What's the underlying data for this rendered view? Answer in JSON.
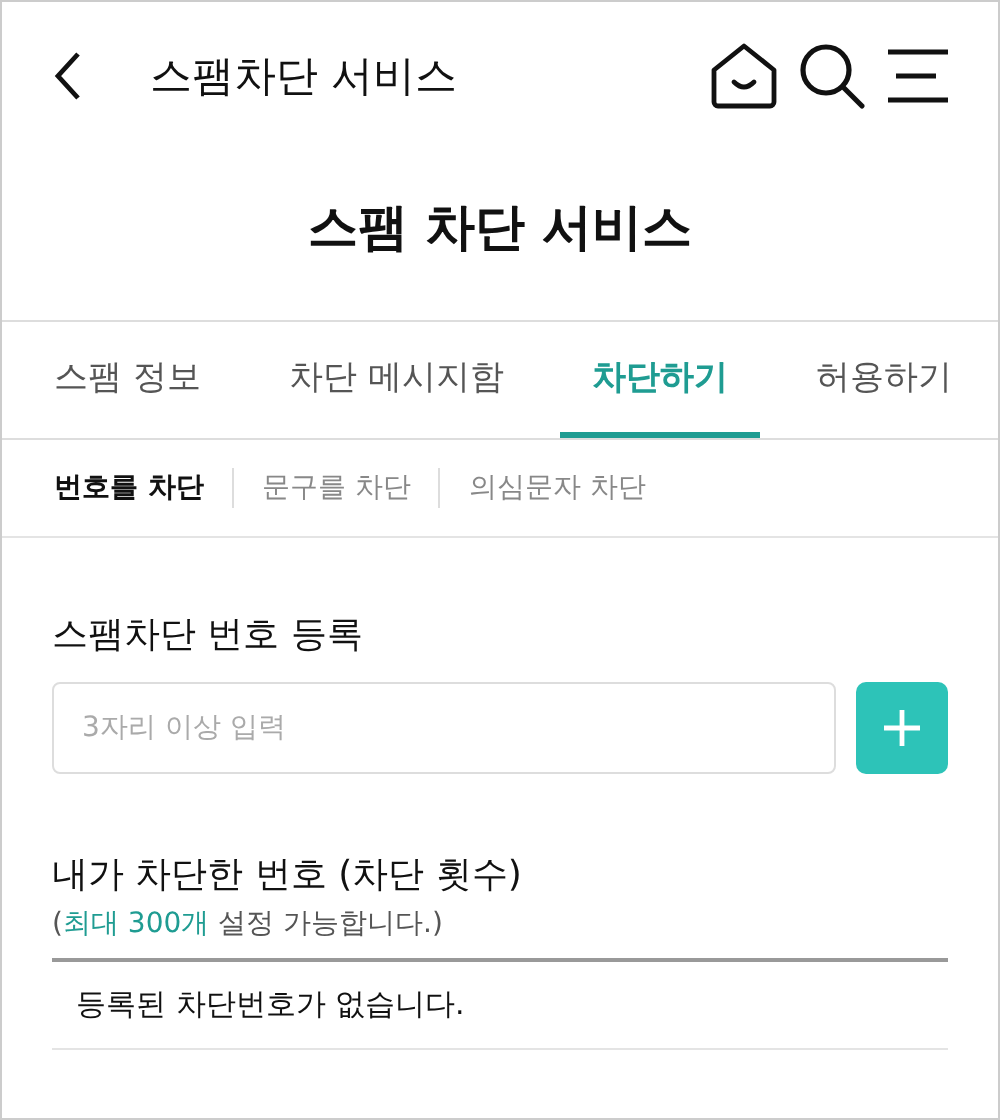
{
  "header": {
    "title": "스팸차단 서비스"
  },
  "page_title": "스팸 차단 서비스",
  "tabs": [
    {
      "label": "스팸 정보",
      "selected": false
    },
    {
      "label": "차단 메시지함",
      "selected": false
    },
    {
      "label": "차단하기",
      "selected": true
    },
    {
      "label": "허용하기",
      "selected": false
    }
  ],
  "subtabs": [
    {
      "label": "번호를 차단",
      "selected": true
    },
    {
      "label": "문구를 차단",
      "selected": false
    },
    {
      "label": "의심문자 차단",
      "selected": false
    }
  ],
  "register": {
    "title": "스팸차단 번호 등록",
    "placeholder": "3자리 이상 입력"
  },
  "blocked": {
    "title": "내가 차단한 번호 (차단 횟수)",
    "note_open": "(",
    "note_highlight": "최대 300개",
    "note_rest": " 설정 가능합니다.)",
    "empty_message": "등록된 차단번호가 없습니다."
  }
}
